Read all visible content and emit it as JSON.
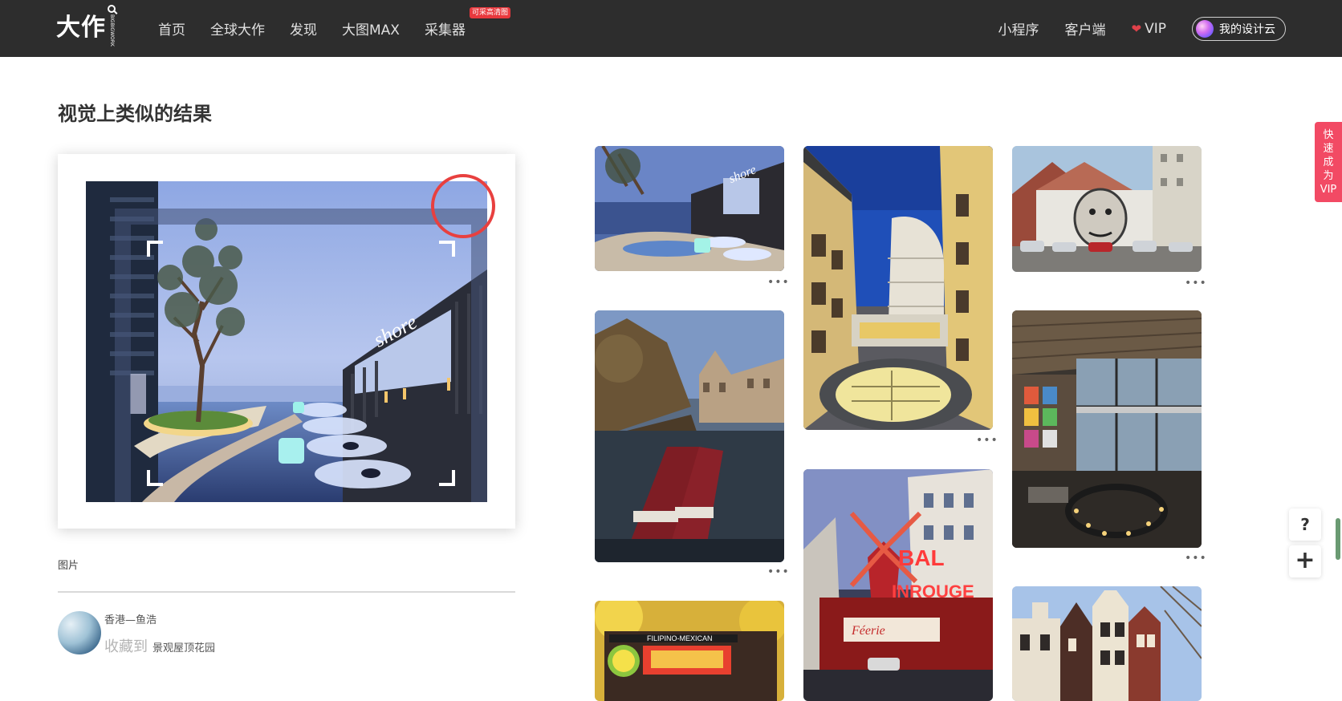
{
  "nav": {
    "logo": "大作",
    "logo_sub": "BIGBIGWORK",
    "left_items": [
      "首页",
      "全球大作",
      "发现",
      "大图MAX",
      "采集器"
    ],
    "collector_badge": "可采高清图",
    "right_items": [
      "小程序",
      "客户端"
    ],
    "vip": "VIP",
    "cloud": "我的设计云"
  },
  "section_title": "视觉上类似的结果",
  "source": {
    "label": "图片",
    "author": "香港—鱼浩",
    "collect_label": "收藏到",
    "collect_target": "景观屋顶花园"
  },
  "results": [
    {
      "id": "r1",
      "subject": "infinity-pool-terrace"
    },
    {
      "id": "r2",
      "subject": "courtyard-apartments"
    },
    {
      "id": "r3",
      "subject": "street-mural"
    },
    {
      "id": "r4",
      "subject": "canal-narrowboats"
    },
    {
      "id": "r5",
      "subject": "loft-interior"
    },
    {
      "id": "r6",
      "subject": "moulin-rouge"
    },
    {
      "id": "r7",
      "subject": "food-truck"
    },
    {
      "id": "r8",
      "subject": "dutch-gables"
    }
  ],
  "more_label": "•••",
  "side": {
    "vip_tab": [
      "快",
      "速",
      "成",
      "为",
      "VIP"
    ],
    "help": "?",
    "add": "+"
  }
}
